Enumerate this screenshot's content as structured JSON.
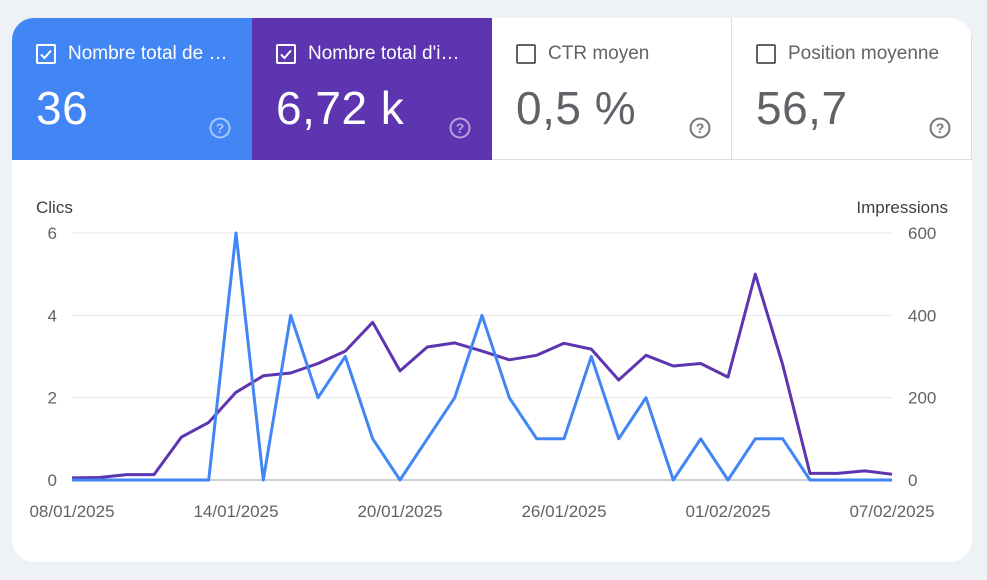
{
  "metrics": {
    "clicks": {
      "label": "Nombre total de …",
      "value": "36",
      "checked": true,
      "color": "#4285f4"
    },
    "impressions": {
      "label": "Nombre total d'i…",
      "value": "6,72 k",
      "checked": true,
      "color": "#5e35b1"
    },
    "ctr": {
      "label": "CTR moyen",
      "value": "0,5 %",
      "checked": false
    },
    "position": {
      "label": "Position moyenne",
      "value": "56,7",
      "checked": false
    }
  },
  "icons": {
    "help": "help-circle-icon",
    "checkbox_checked": "checkbox-checked-icon",
    "checkbox_empty": "checkbox-empty-icon"
  },
  "chart_data": {
    "type": "line",
    "left_axis_title": "Clics",
    "right_axis_title": "Impressions",
    "left_ticks": [
      "6",
      "4",
      "2",
      "0"
    ],
    "right_ticks": [
      "600",
      "400",
      "200",
      "0"
    ],
    "ylim_left": [
      0,
      6
    ],
    "ylim_right": [
      0,
      600
    ],
    "x_tick_labels": [
      "08/01/2025",
      "14/01/2025",
      "20/01/2025",
      "26/01/2025",
      "01/02/2025",
      "07/02/2025"
    ],
    "x_tick_index": [
      0,
      6,
      12,
      18,
      24,
      30
    ],
    "x": [
      "08/01/2025",
      "09/01/2025",
      "10/01/2025",
      "11/01/2025",
      "12/01/2025",
      "13/01/2025",
      "14/01/2025",
      "15/01/2025",
      "16/01/2025",
      "17/01/2025",
      "18/01/2025",
      "19/01/2025",
      "20/01/2025",
      "21/01/2025",
      "22/01/2025",
      "23/01/2025",
      "24/01/2025",
      "25/01/2025",
      "26/01/2025",
      "27/01/2025",
      "28/01/2025",
      "29/01/2025",
      "30/01/2025",
      "31/01/2025",
      "01/02/2025",
      "02/02/2025",
      "03/02/2025",
      "04/02/2025",
      "05/02/2025",
      "06/02/2025",
      "07/02/2025"
    ],
    "series": [
      {
        "name": "Clics",
        "axis": "left",
        "color": "#4285f4",
        "values": [
          0,
          0,
          0,
          0,
          0,
          0,
          6,
          0,
          4,
          2,
          3,
          1,
          0,
          1,
          2,
          4,
          2,
          1,
          1,
          3,
          1,
          2,
          0,
          1,
          0,
          1,
          1,
          0,
          0,
          0,
          0
        ]
      },
      {
        "name": "Impressions",
        "axis": "right",
        "color": "#5e35b1",
        "values": [
          5,
          6,
          13,
          13,
          104,
          140,
          213,
          253,
          260,
          283,
          313,
          383,
          265,
          323,
          333,
          313,
          292,
          303,
          332,
          318,
          243,
          303,
          277,
          283,
          250,
          500,
          280,
          16,
          16,
          22,
          14
        ]
      }
    ],
    "grid": true
  }
}
